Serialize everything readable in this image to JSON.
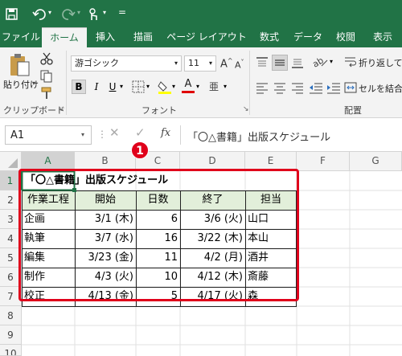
{
  "tabs": [
    "ファイル",
    "ホーム",
    "挿入",
    "描画",
    "ページ レイアウト",
    "数式",
    "データ",
    "校閲",
    "表示"
  ],
  "ribbon": {
    "paste_label": "貼り付け",
    "clipboard_label": "クリップボード",
    "font_name": "游ゴシック",
    "font_size": "11",
    "bold": "B",
    "italic": "I",
    "underline": "U",
    "font_color_letter": "A",
    "highlight_letter": "A",
    "font_group_label": "フォント",
    "wrap_label": "折り返して",
    "merge_label": "セルを結合",
    "align_group_label": "配置",
    "grow_font": "A",
    "shrink_font": "A",
    "phonetic": "亜"
  },
  "formula_bar": {
    "name_box": "A1",
    "fx": "fx",
    "content": "「〇△書籍」出版スケジュール"
  },
  "marker": "1",
  "columns": [
    "A",
    "B",
    "C",
    "D",
    "E",
    "F",
    "G"
  ],
  "rows": [
    "1",
    "2",
    "3",
    "4",
    "5",
    "6",
    "7",
    "8",
    "9",
    "10"
  ],
  "sheet": {
    "title": "「〇△書籍」出版スケジュール",
    "headers": [
      "作業工程",
      "開始",
      "日数",
      "終了",
      "担当"
    ],
    "data": [
      [
        "企画",
        "3/1 (木)",
        "6",
        "3/6 (火)",
        "山口"
      ],
      [
        "執筆",
        "3/7 (水)",
        "16",
        "3/22 (木)",
        "本山"
      ],
      [
        "編集",
        "3/23 (金)",
        "11",
        "4/2 (月)",
        "酒井"
      ],
      [
        "制作",
        "4/3 (火)",
        "10",
        "4/12 (木)",
        "斎藤"
      ],
      [
        "校正",
        "4/13 (金)",
        "5",
        "4/17 (火)",
        "森"
      ]
    ]
  },
  "colors": {
    "accent": "#217346",
    "header_fill": "#e2efda",
    "highlight_border": "#e0001b"
  }
}
